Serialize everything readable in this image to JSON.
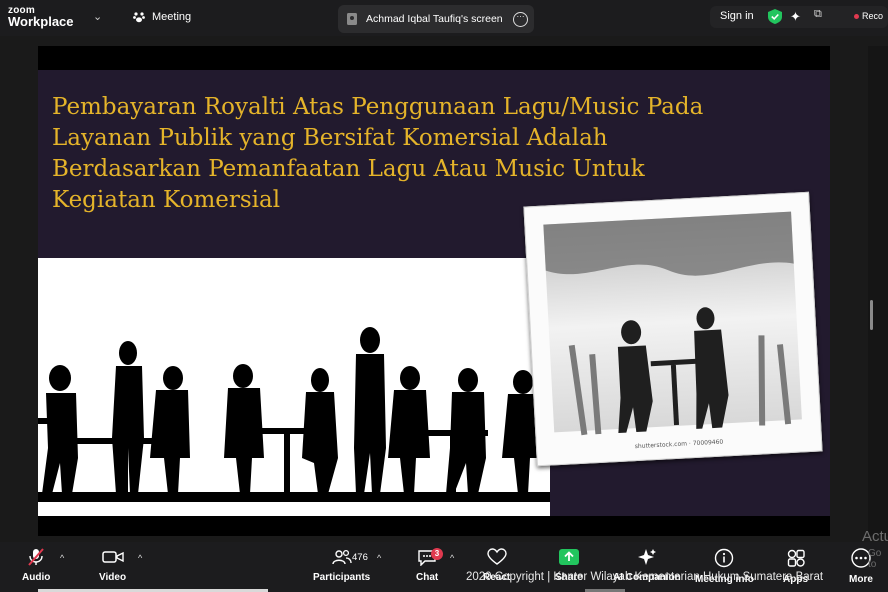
{
  "app": {
    "brand_line1": "zoom",
    "brand_line2": "Workplace"
  },
  "topbar": {
    "meeting_label": "Meeting",
    "share_tab_label": "Achmad Iqbal Taufiq's screen",
    "sign_in_label": "Sign in",
    "record_label": "Reco"
  },
  "slide": {
    "title_lines": [
      "Pembayaran Royalti Atas Penggunaan Lagu/Music Pada",
      "Layanan Publik yang  Bersifat Komersial Adalah",
      "Berdasarkan Pemanfaatan Lagu Atau Music Untuk",
      "Kegiatan Komersial"
    ],
    "photo_caption": "shutterstock.com · 70009460",
    "title_color": "#e5b42a",
    "background_color": "#221a2e"
  },
  "toolbar": {
    "audio": "Audio",
    "video": "Video",
    "participants": "Participants",
    "participant_count": "476",
    "chat": "Chat",
    "chat_badge": "3",
    "react": "React",
    "share": "Share",
    "ai_companion": "AI Companion",
    "meeting_info": "Meeting info",
    "apps": "Apps",
    "more": "More"
  },
  "overlay": {
    "copyright": "2020 Copyright | Kantor Wilayah Kementerian Hukum Sumatera Barat",
    "activate_1": "Actu",
    "activate_2": "Go to"
  },
  "colors": {
    "accent_share": "#22c55e",
    "badge": "#e0394f",
    "shield_ok": "#22c55e"
  }
}
